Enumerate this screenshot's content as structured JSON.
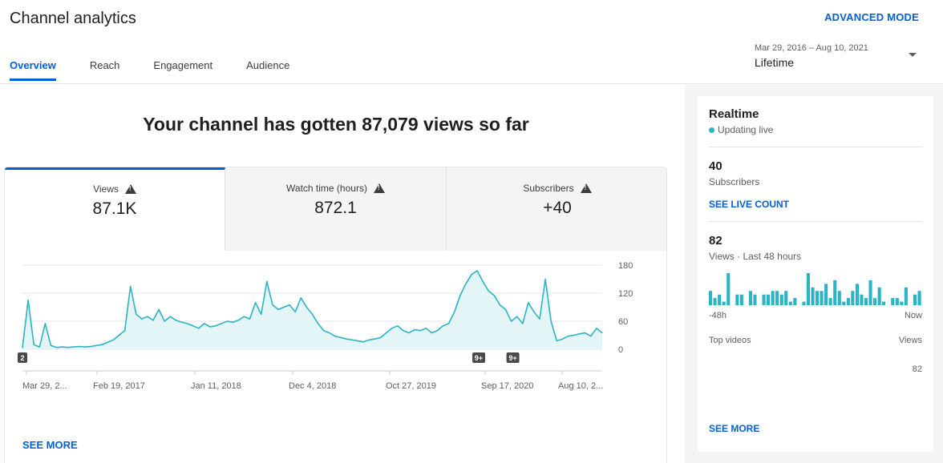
{
  "header": {
    "title": "Channel analytics",
    "advanced_mode": "ADVANCED MODE",
    "tabs": [
      "Overview",
      "Reach",
      "Engagement",
      "Audience"
    ],
    "date_range": "Mar 29, 2016 – Aug 10, 2021",
    "period": "Lifetime"
  },
  "main": {
    "headline": "Your channel has gotten 87,079 views so far",
    "metrics": [
      {
        "label": "Views",
        "value": "87.1K"
      },
      {
        "label": "Watch time (hours)",
        "value": "872.1"
      },
      {
        "label": "Subscribers",
        "value": "+40"
      }
    ],
    "see_more": "SEE MORE"
  },
  "chart_data": {
    "type": "area",
    "title": "",
    "xlabel": "",
    "ylabel": "",
    "ylim": [
      0,
      180
    ],
    "y_ticks": [
      "180",
      "120",
      "60",
      "0"
    ],
    "x_ticks": [
      "Mar 29, 2...",
      "Feb 19, 2017",
      "Jan 11, 2018",
      "Dec 4, 2018",
      "Oct 27, 2019",
      "Sep 17, 2020",
      "Aug 10, 2..."
    ],
    "series": [
      {
        "values": [
          3,
          105,
          10,
          5,
          55,
          8,
          4,
          5,
          4,
          5,
          6,
          5,
          6,
          8,
          10,
          15,
          20,
          30,
          40,
          135,
          75,
          65,
          70,
          62,
          85,
          60,
          70,
          62,
          58,
          55,
          50,
          45,
          55,
          48,
          50,
          55,
          60,
          58,
          62,
          70,
          65,
          100,
          75,
          145,
          95,
          85,
          90,
          95,
          80,
          110,
          90,
          75,
          55,
          40,
          35,
          28,
          25,
          22,
          20,
          18,
          16,
          20,
          22,
          25,
          35,
          45,
          50,
          40,
          35,
          42,
          40,
          45,
          35,
          40,
          50,
          55,
          80,
          115,
          140,
          160,
          168,
          145,
          125,
          115,
          95,
          85,
          60,
          70,
          55,
          100,
          80,
          65,
          150,
          60,
          18,
          22,
          28,
          30,
          33,
          35,
          28,
          45,
          35
        ]
      }
    ],
    "annotations": [
      {
        "x_index": 0,
        "label": "2"
      },
      {
        "x_index": 80,
        "label": "9+"
      },
      {
        "x_index": 86,
        "label": "9+"
      }
    ],
    "color": "#2bb4c5",
    "fill": "#e3f5f7",
    "grid": true
  },
  "realtime": {
    "title": "Realtime",
    "live": "Updating live",
    "subscribers_value": "40",
    "subscribers_label": "Subscribers",
    "see_live": "SEE LIVE COUNT",
    "views_value": "82",
    "views_label": "Views · Last 48 hours",
    "bars": [
      4,
      2,
      3,
      1,
      9,
      0,
      3,
      3,
      0,
      4,
      3,
      0,
      3,
      3,
      4,
      4,
      3,
      4,
      1,
      2,
      0,
      1,
      9,
      5,
      4,
      4,
      6,
      2,
      7,
      4,
      1,
      2,
      4,
      6,
      3,
      2,
      7,
      2,
      5,
      1,
      0,
      2,
      2,
      1,
      5,
      0,
      3,
      4
    ],
    "axis_left": "-48h",
    "axis_right": "Now",
    "top_videos": "Top videos",
    "views_col": "Views",
    "top_value": "82",
    "see_more": "SEE MORE",
    "color": "#2bb4c5"
  }
}
